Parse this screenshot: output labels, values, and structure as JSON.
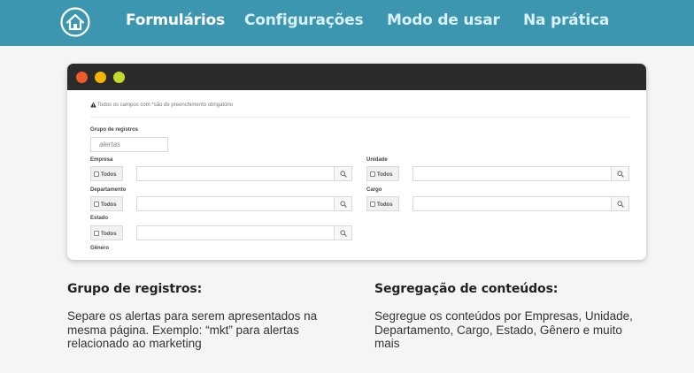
{
  "nav": {
    "items": [
      {
        "label": "Formulários",
        "active": true
      },
      {
        "label": "Configurações",
        "active": false
      },
      {
        "label": "Modo de usar",
        "active": false
      },
      {
        "label": "Na prática",
        "active": false
      }
    ],
    "home_icon": "home-icon",
    "bg_color": "#3d96b0"
  },
  "window": {
    "dots": [
      "#ef5b29",
      "#f4b400",
      "#c4d92e"
    ],
    "notice": "Todos os campos com *são de preenchimento obrigatório",
    "groups_label": "Grupo de registros",
    "groups_value": "alertas",
    "todos_label": "Todos",
    "fields": {
      "empresa": "Empresa",
      "unidade": "Unidade",
      "departamento": "Departamento",
      "cargo": "Cargo",
      "estado": "Estado",
      "genero": "Gênero"
    }
  },
  "sections": {
    "left": {
      "title": "Grupo de registros:",
      "body": "Separe os alertas para serem apresentados na mesma página. Exemplo: “mkt” para alertas relacionado ao marketing"
    },
    "right": {
      "title": "Segregação de conteúdos:",
      "body": "Segregue os conteúdos por Empresas, Unidade, Departamento, Cargo, Estado, Gênero e muito mais"
    }
  }
}
